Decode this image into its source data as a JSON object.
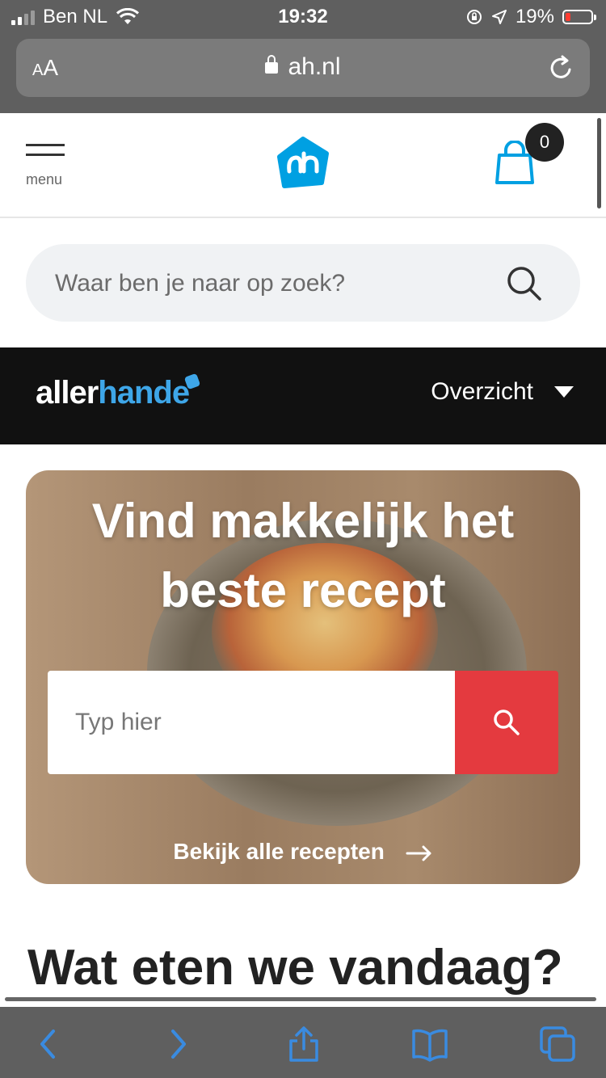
{
  "status_bar": {
    "carrier": "Ben NL",
    "time": "19:32",
    "battery": "19%",
    "battery_level": 0.19
  },
  "browser": {
    "text_size": "AA",
    "url": "ah.nl"
  },
  "header": {
    "menu_label": "menu",
    "cart_count": "0"
  },
  "search": {
    "placeholder": "Waar ben je naar op zoek?"
  },
  "allerhande": {
    "logo_part1": "aller",
    "logo_part2": "hande",
    "nav_label": "Overzicht"
  },
  "hero": {
    "title_line1": "Vind makkelijk het",
    "title_line2": "beste recept",
    "search_placeholder": "Typ hier",
    "link_label": "Bekijk alle recepten"
  },
  "section": {
    "title": "Wat eten we vandaag?"
  },
  "colors": {
    "ah_blue": "#00a0e2",
    "search_red": "#e43a3f",
    "allerhande_blue": "#3ea6e8"
  }
}
